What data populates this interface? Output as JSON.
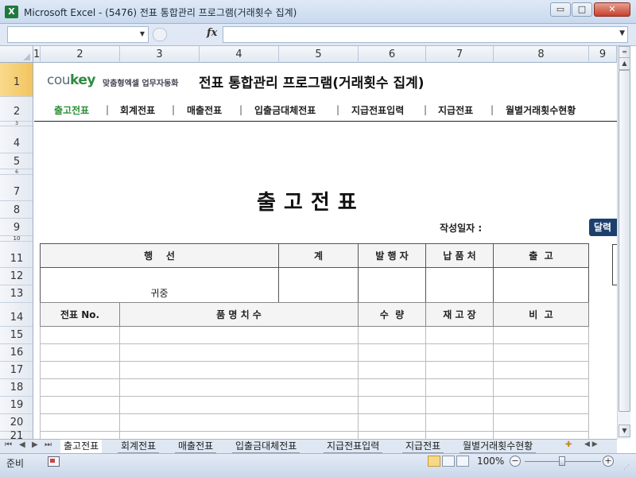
{
  "window": {
    "app_icon": "X",
    "title": "Microsoft Excel - (5476) 전표 통합관리 프로그램(거래횟수 집계)",
    "minimize_icon": "minimize-icon",
    "maximize_icon": "maximize-icon",
    "close_icon": "close-icon",
    "min_glyph": "▭",
    "max_glyph": "□",
    "close_glyph": "✕"
  },
  "formula_bar": {
    "name_box_value": "",
    "fx_label": "fx",
    "formula_value": ""
  },
  "columns": [
    "1",
    "2",
    "3",
    "4",
    "5",
    "6",
    "7",
    "8",
    "9"
  ],
  "rows": [
    "1",
    "2",
    "3",
    "4",
    "5",
    "6",
    "7",
    "8",
    "9",
    "10",
    "11",
    "12",
    "13",
    "14",
    "15",
    "16",
    "17",
    "18",
    "19",
    "20",
    "21"
  ],
  "header": {
    "logo_light": "cou",
    "logo_bold": "key",
    "logo_sub": "맞춤형엑셀 업무자동화",
    "title": "전표 통합관리 프로그램(거래횟수 집계)"
  },
  "nav": {
    "items": [
      "출고전표",
      "회계전표",
      "매출전표",
      "입출금대체전표",
      "지급전표입력",
      "지급전표",
      "월별거래횟수현황"
    ],
    "separator": "|",
    "active_index": 0
  },
  "document": {
    "title": "출고전표",
    "date_label": "작성일자 :",
    "calendar_button": "달력",
    "approval_headers": [
      "행    선",
      "계",
      "발 행 자",
      "납 품 처",
      "출  고"
    ],
    "recipient_suffix": "귀중",
    "item_headers": [
      "전표 No.",
      "품 명 치 수",
      "수  량",
      "재 고 장",
      "비  고"
    ]
  },
  "sheet_tabs": {
    "items": [
      "출고전표",
      "회계전표",
      "매출전표",
      "입출금대체전표",
      "지급전표입력",
      "지급전표",
      "월별거래횟수현황"
    ],
    "active_index": 0
  },
  "status_bar": {
    "ready": "준비",
    "zoom": "100%",
    "zoom_out": "−",
    "zoom_in": "+"
  }
}
